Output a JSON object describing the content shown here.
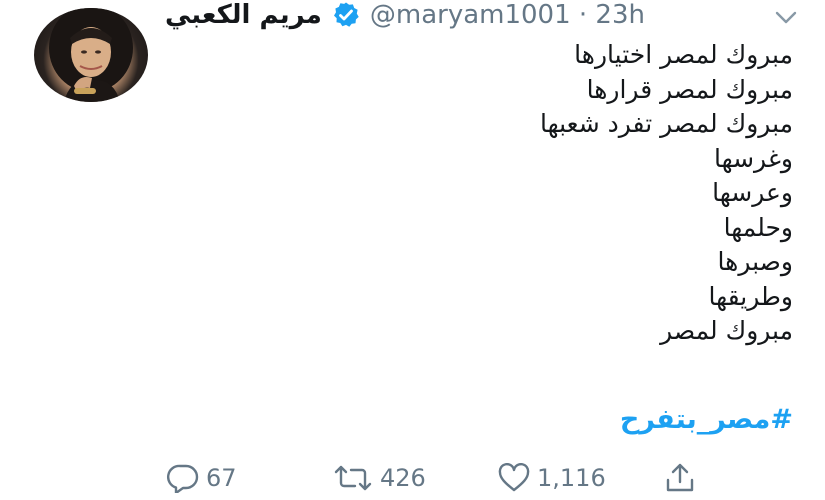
{
  "author": {
    "display_name": "مريم الكعبي",
    "handle_time": "@maryam1001 · 23h",
    "verified": true
  },
  "tweet": {
    "lines": [
      "مبروك لمصر اختيارها",
      "مبروك لمصر قرارها",
      "مبروك لمصر تفرد شعبها",
      "وغرسها",
      "وعرسها",
      "وحلمها",
      "وصبرها",
      "وطريقها",
      "مبروك لمصر"
    ],
    "hashtag": "#مصر_بتفرح"
  },
  "actions": {
    "replies": "67",
    "retweets": "426",
    "likes": "1,116"
  },
  "icons": {
    "verified": "verified-badge-icon",
    "menu": "chevron-down-icon",
    "reply": "reply-icon",
    "retweet": "retweet-icon",
    "like": "heart-icon",
    "share": "share-icon"
  },
  "colors": {
    "text": "#14171a",
    "secondary": "#657786",
    "link": "#1da1f2"
  }
}
